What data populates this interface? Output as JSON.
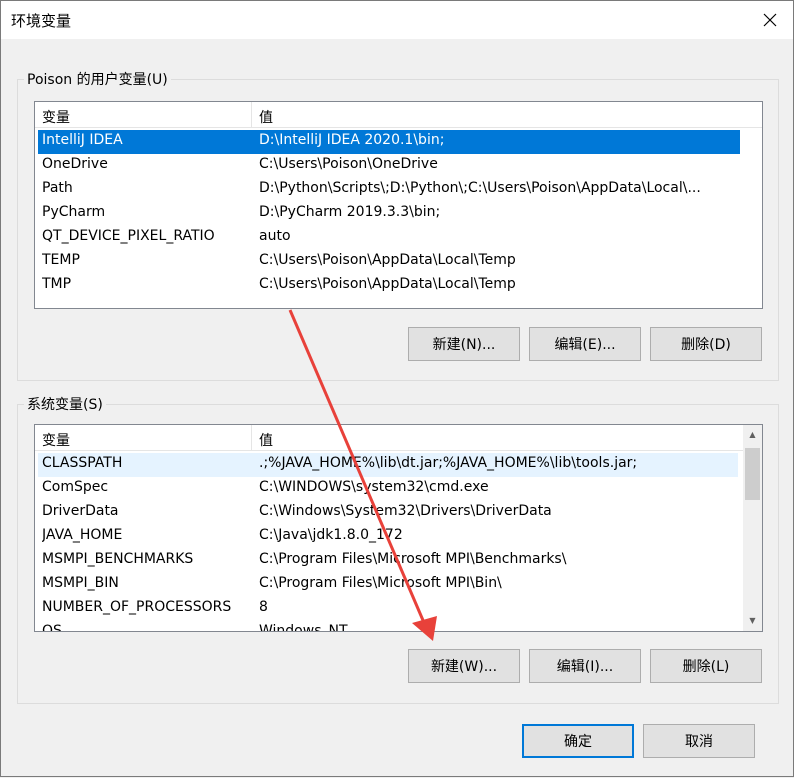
{
  "window": {
    "title": "环境变量"
  },
  "user_vars": {
    "group_label": "Poison 的用户变量(U)",
    "columns": [
      "变量",
      "值"
    ],
    "rows": [
      {
        "name": "IntelliJ IDEA",
        "value": "D:\\IntelliJ IDEA 2020.1\\bin;"
      },
      {
        "name": "OneDrive",
        "value": "C:\\Users\\Poison\\OneDrive"
      },
      {
        "name": "Path",
        "value": "D:\\Python\\Scripts\\;D:\\Python\\;C:\\Users\\Poison\\AppData\\Local\\..."
      },
      {
        "name": "PyCharm",
        "value": "D:\\PyCharm 2019.3.3\\bin;"
      },
      {
        "name": "QT_DEVICE_PIXEL_RATIO",
        "value": "auto"
      },
      {
        "name": "TEMP",
        "value": "C:\\Users\\Poison\\AppData\\Local\\Temp"
      },
      {
        "name": "TMP",
        "value": "C:\\Users\\Poison\\AppData\\Local\\Temp"
      }
    ],
    "selected_index": 0,
    "buttons": {
      "new": "新建(N)...",
      "edit": "编辑(E)...",
      "delete": "删除(D)"
    }
  },
  "system_vars": {
    "group_label": "系统变量(S)",
    "columns": [
      "变量",
      "值"
    ],
    "rows": [
      {
        "name": "CLASSPATH",
        "value": ".;%JAVA_HOME%\\lib\\dt.jar;%JAVA_HOME%\\lib\\tools.jar;"
      },
      {
        "name": "ComSpec",
        "value": "C:\\WINDOWS\\system32\\cmd.exe"
      },
      {
        "name": "DriverData",
        "value": "C:\\Windows\\System32\\Drivers\\DriverData"
      },
      {
        "name": "JAVA_HOME",
        "value": "C:\\Java\\jdk1.8.0_172"
      },
      {
        "name": "MSMPI_BENCHMARKS",
        "value": "C:\\Program Files\\Microsoft MPI\\Benchmarks\\"
      },
      {
        "name": "MSMPI_BIN",
        "value": "C:\\Program Files\\Microsoft MPI\\Bin\\"
      },
      {
        "name": "NUMBER_OF_PROCESSORS",
        "value": "8"
      },
      {
        "name": "OS",
        "value": "Windows_NT"
      }
    ],
    "highlighted_index": 0,
    "buttons": {
      "new": "新建(W)...",
      "edit": "编辑(I)...",
      "delete": "删除(L)"
    }
  },
  "footer": {
    "ok": "确定",
    "cancel": "取消"
  },
  "colors": {
    "selection": "#0078d7",
    "hover": "#e5f3ff",
    "annotation_arrow": "#e8413a"
  },
  "icons": {
    "close": "close-icon",
    "scroll_up": "chevron-up-icon",
    "scroll_down": "chevron-down-icon"
  }
}
